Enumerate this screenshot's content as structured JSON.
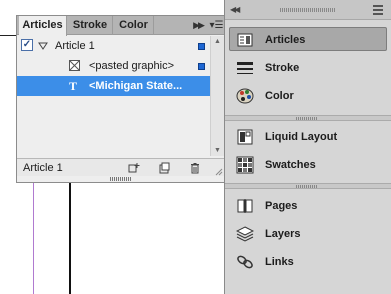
{
  "panel": {
    "tabs": [
      {
        "label": "Articles",
        "active": true
      },
      {
        "label": "Stroke",
        "active": false
      },
      {
        "label": "Color",
        "active": false
      }
    ],
    "tab_overflow_icon": "double-chevron-right-icon",
    "menu_icon": "panel-menu-icon",
    "rows": [
      {
        "label": "Article 1",
        "checked": true,
        "expanded": true,
        "icon": "disclosure-triangle-icon"
      },
      {
        "label": "<pasted graphic>",
        "icon": "graphic-frame-icon"
      },
      {
        "label": "<Michigan State...",
        "icon": "text-frame-icon",
        "selected": true
      }
    ],
    "footer": {
      "label": "Article 1",
      "buttons": [
        "add-selection-icon",
        "new-article-icon",
        "trash-icon"
      ]
    }
  },
  "dock": {
    "groups": [
      {
        "items": [
          {
            "label": "Articles",
            "icon": "articles-icon",
            "active": true
          },
          {
            "label": "Stroke",
            "icon": "stroke-icon"
          },
          {
            "label": "Color",
            "icon": "palette-icon"
          }
        ]
      },
      {
        "items": [
          {
            "label": "Liquid Layout",
            "icon": "liquid-layout-icon"
          },
          {
            "label": "Swatches",
            "icon": "swatches-icon"
          }
        ]
      },
      {
        "items": [
          {
            "label": "Pages",
            "icon": "pages-icon"
          },
          {
            "label": "Layers",
            "icon": "layers-icon"
          },
          {
            "label": "Links",
            "icon": "links-icon"
          }
        ]
      }
    ]
  },
  "colors": {
    "selection": "#3c8ee8",
    "marker": "#1d66d3",
    "dock_bg": "#d6d6d6",
    "panel_bg": "#eeeeee"
  }
}
